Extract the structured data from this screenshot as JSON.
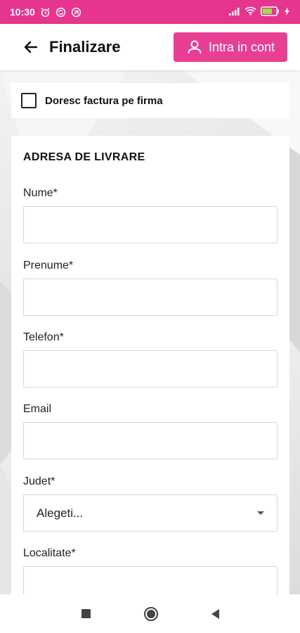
{
  "status_bar": {
    "time": "10:30",
    "battery_color": "#9ee04a"
  },
  "app_bar": {
    "title": "Finalizare",
    "login_label": "Intra in cont"
  },
  "invoice": {
    "label": "Doresc factura pe firma",
    "checked": false
  },
  "form": {
    "section_title": "ADRESA DE LIVRARE",
    "fields": [
      {
        "label": "Nume*",
        "value": ""
      },
      {
        "label": "Prenume*",
        "value": ""
      },
      {
        "label": "Telefon*",
        "value": ""
      },
      {
        "label": "Email",
        "value": ""
      },
      {
        "label": "Judet*",
        "selected": "Alegeti..."
      },
      {
        "label": "Localitate*",
        "value": ""
      }
    ]
  },
  "colors": {
    "accent": "#e83f95",
    "status_bar": "#e5358e"
  }
}
